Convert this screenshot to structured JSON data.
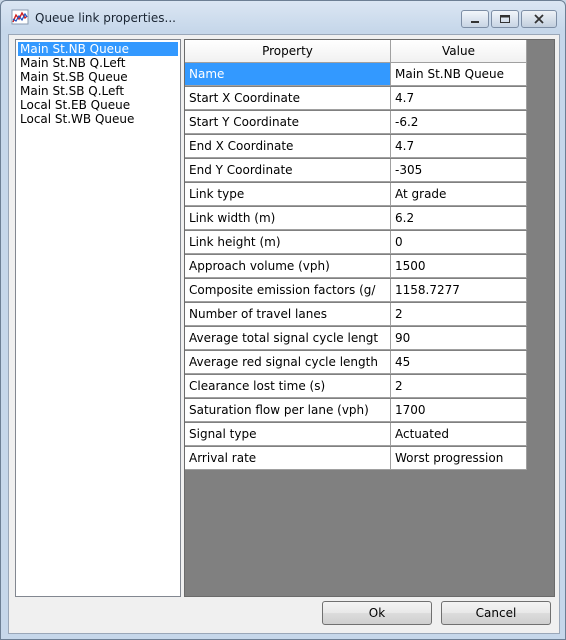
{
  "window": {
    "title": "Queue link properties..."
  },
  "queue_list": {
    "items": [
      {
        "label": "Main St.NB Queue",
        "selected": true
      },
      {
        "label": "Main St.NB Q.Left",
        "selected": false
      },
      {
        "label": "Main St.SB Queue",
        "selected": false
      },
      {
        "label": "Main St.SB Q.Left",
        "selected": false
      },
      {
        "label": "Local St.EB Queue",
        "selected": false
      },
      {
        "label": "Local St.WB Queue",
        "selected": false
      }
    ]
  },
  "property_grid": {
    "headers": {
      "property": "Property",
      "value": "Value"
    },
    "rows": [
      {
        "property": "Name",
        "value": "Main St.NB Queue",
        "selected": true
      },
      {
        "property": "Start X Coordinate",
        "value": "4.7"
      },
      {
        "property": "Start Y Coordinate",
        "value": "-6.2"
      },
      {
        "property": "End X Coordinate",
        "value": "4.7"
      },
      {
        "property": "End Y Coordinate",
        "value": "-305"
      },
      {
        "property": "Link type",
        "value": "At grade"
      },
      {
        "property": "Link width (m)",
        "value": "6.2"
      },
      {
        "property": "Link height (m)",
        "value": "0"
      },
      {
        "property": "Approach volume (vph)",
        "value": "1500"
      },
      {
        "property": "Composite emission factors (g/",
        "value": "1158.7277"
      },
      {
        "property": "Number of travel lanes",
        "value": "2"
      },
      {
        "property": "Average total signal cycle lengt",
        "value": "90"
      },
      {
        "property": "Average red signal cycle length",
        "value": "45"
      },
      {
        "property": "Clearance lost time (s)",
        "value": "2"
      },
      {
        "property": "Saturation flow per lane (vph)",
        "value": "1700"
      },
      {
        "property": "Signal type",
        "value": "Actuated"
      },
      {
        "property": "Arrival rate",
        "value": "Worst progression"
      }
    ]
  },
  "buttons": {
    "ok": "Ok",
    "cancel": "Cancel"
  },
  "colors": {
    "selection": "#3399ff",
    "grid_background": "#808080",
    "title_bar": "#c6d7ea"
  },
  "icons": {
    "app": "chart-app-icon",
    "minimize": "minimize-icon",
    "maximize": "maximize-icon",
    "close": "close-icon"
  }
}
